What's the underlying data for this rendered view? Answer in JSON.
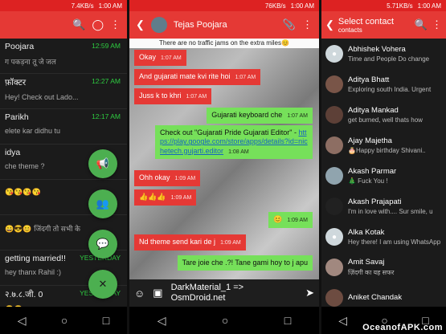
{
  "status": {
    "time": "1:00 AM",
    "speed_p1": "7.4KB/s",
    "speed_p2": "76KB/s",
    "speed_p3": "5.71KB/s"
  },
  "panel1": {
    "chats": [
      {
        "name": "Poojara",
        "preview": "ग पकड़ना तू जे जल",
        "time": "12:59 AM"
      },
      {
        "name": "फ़ॉक्टर",
        "preview": "Hey! Check out Lado...",
        "time": "12:27 AM"
      },
      {
        "name": "Parikh",
        "preview": "elete kar didhu tu",
        "time": "12:17 AM"
      },
      {
        "name": "idya",
        "preview": "che theme ?",
        "time": ""
      },
      {
        "name": "",
        "preview": "😘😘😘😘",
        "time": ""
      },
      {
        "name": "",
        "preview": "😄😎😊 जिंदगी तो सभी के",
        "time": ""
      },
      {
        "name": "getting married!!",
        "preview": "hey thanx Rahil :)",
        "time": "YESTERDAY"
      },
      {
        "name": "२.७.८.जी. 0",
        "preview": "😊😊",
        "time": "YESTERDAY"
      }
    ]
  },
  "panel2": {
    "contact_name": "Tejas Poojara",
    "banner": "There are no traffic jams on the extra miles😊",
    "messages": [
      {
        "text": "Okay",
        "time": "1:07 AM",
        "side": "left"
      },
      {
        "text": "And gujarati mate kvi rite hoi",
        "time": "1:07 AM",
        "side": "left"
      },
      {
        "text": "Juss k to khri",
        "time": "1:07 AM",
        "side": "left"
      },
      {
        "text": "Gujarati keyboard che",
        "time": "1:07 AM",
        "side": "right"
      },
      {
        "text": "Check out \"Gujarati Pride Gujarati Editor\" -",
        "link": "https://play.google.com/store/apps/details?id=nichetech.gujarti.editor",
        "time": "1:08 AM",
        "side": "right"
      },
      {
        "text": "Ohh okay",
        "time": "1:09 AM",
        "side": "left"
      },
      {
        "text": "👍👍👍",
        "time": "1:09 AM",
        "side": "left"
      },
      {
        "text": "😊",
        "time": "1:09 AM",
        "side": "right"
      },
      {
        "text": "Nd theme send kari de j",
        "time": "1:09 AM",
        "side": "left"
      },
      {
        "text": "Tare joie che .?! Tane gami hoy to j apu",
        "time": "",
        "side": "right"
      }
    ],
    "input_text": "DarkMaterial_1 => OsmDroid.net"
  },
  "panel3": {
    "title": "Select contact",
    "subtitle": "contacts",
    "contacts": [
      {
        "name": "Abhishek Vohera",
        "status": "Time and People Do change"
      },
      {
        "name": "Aditya Bhatt",
        "status": "Exploring south India. Urgent"
      },
      {
        "name": "Aditya Mankad",
        "status": "get burned, well thats how"
      },
      {
        "name": "Ajay Majetha",
        "status": "🎂Happy birthday Shivani.."
      },
      {
        "name": "Akash Parmar",
        "status": "🎄 Fuck You !"
      },
      {
        "name": "Akash Prajapati",
        "status": "I'm in love with.... Sur smile, u"
      },
      {
        "name": "Alka Kotak",
        "status": "Hey there! I am using WhatsApp"
      },
      {
        "name": "Amit Savaj",
        "status": "ज़िंदगी का यह सफर"
      },
      {
        "name": "Aniket Chandak",
        "status": ""
      }
    ],
    "watermark": "OceanofAPK.com"
  }
}
